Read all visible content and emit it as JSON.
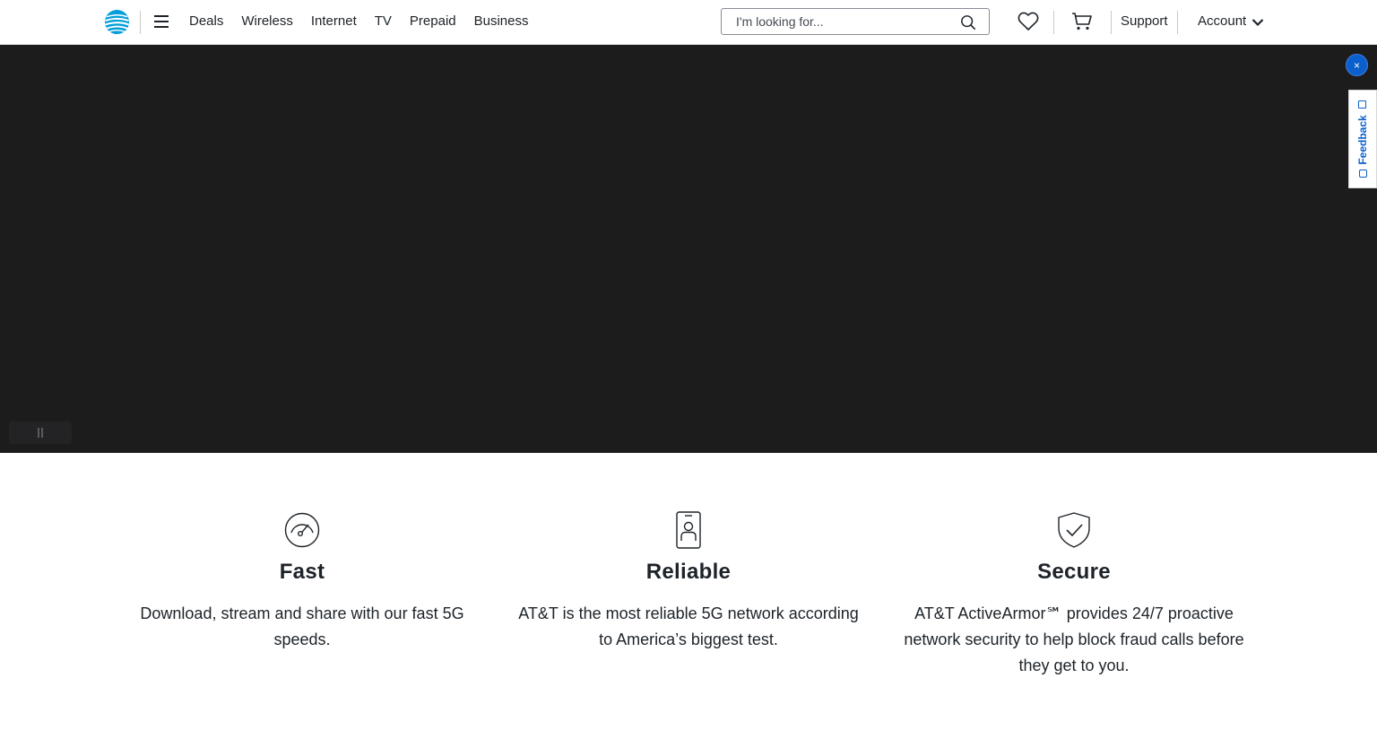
{
  "header": {
    "nav": [
      "Deals",
      "Wireless",
      "Internet",
      "TV",
      "Prepaid",
      "Business"
    ],
    "search_placeholder": "I'm looking for...",
    "support_label": "Support",
    "account_label": "Account"
  },
  "hero": {
    "background_color": "#1c1c1d"
  },
  "overlay": {
    "close_label": "×",
    "feedback_label": "Feedback"
  },
  "features": [
    {
      "icon": "speedometer-icon",
      "title": "Fast",
      "text": "Download, stream and share with our fast 5G speeds."
    },
    {
      "icon": "phone-person-icon",
      "title": "Reliable",
      "text": "AT&T is the most reliable 5G network according to America’s biggest test."
    },
    {
      "icon": "shield-check-icon",
      "title": "Secure",
      "text": "AT&T ActiveArmor℠ provides 24/7 proactive network security to help block fraud calls before they get to you."
    }
  ],
  "colors": {
    "accent_blue": "#0b5fcc",
    "att_logo_blue": "#009fdb",
    "text": "#1d2329"
  }
}
